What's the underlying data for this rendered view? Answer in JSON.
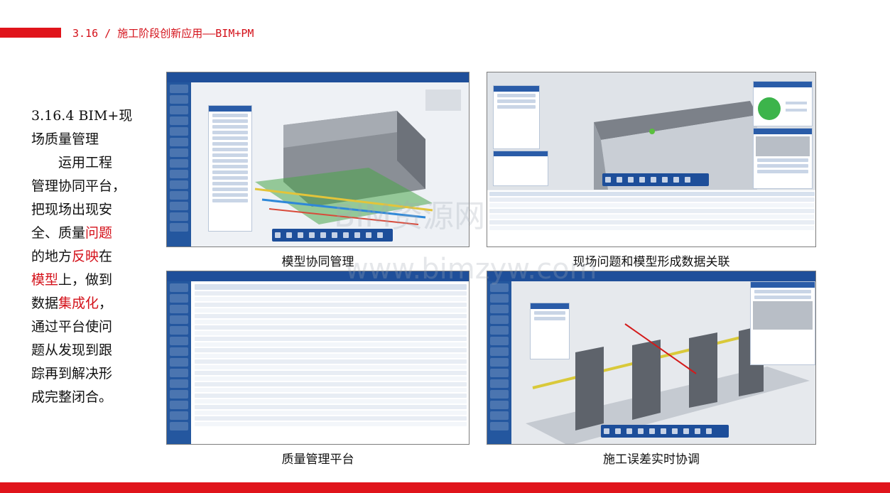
{
  "header": {
    "title": "3.16 / 施工阶段创新应用——BIM+PM"
  },
  "section": {
    "title_line1": "3.16.4 BIM+现",
    "title_line2": "场质量管理",
    "p1": "运用工程",
    "p2": "管理协同平台，",
    "p3": "把现场出现安",
    "p4_a": "全、质量",
    "p4_hl": "问题",
    "p5_a": "的地方",
    "p5_hl": "反映",
    "p5_b": "在",
    "p6_hl": "模型",
    "p6_b": "上，做到",
    "p7_a": "数据",
    "p7_hl": "集成化",
    "p7_b": "，",
    "p8": "通过平台使问",
    "p9": "题从发现到跟",
    "p10": "踪再到解决形",
    "p11": "成完整闭合。"
  },
  "captions": {
    "img1": "模型协同管理",
    "img2": "现场问题和模型形成数据关联",
    "img3": "质量管理平台",
    "img4": "施工误差实时协调"
  },
  "watermark": {
    "line1": "BIM资源网",
    "line2": "www.bimzyw.com"
  },
  "colors": {
    "accent": "#e0141b",
    "text": "#111111",
    "app_blue": "#1f4f9a"
  }
}
